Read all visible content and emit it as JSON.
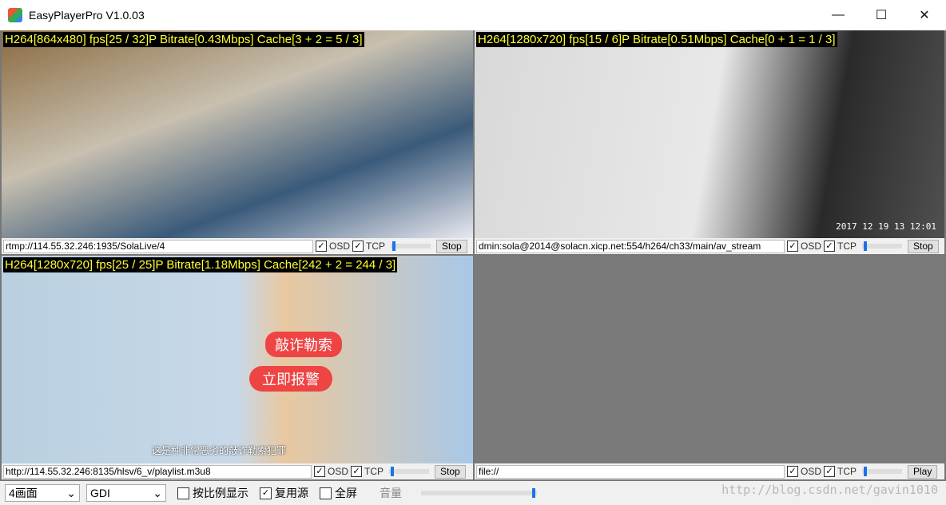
{
  "window": {
    "title": "EasyPlayerPro V1.0.03",
    "minimize": "—",
    "maximize": "☐",
    "close": "✕"
  },
  "panes": [
    {
      "osd": "H264[864x480] fps[25 / 32]P Bitrate[0.43Mbps] Cache[3 + 2 = 5 / 3]",
      "url": "rtmp://114.55.32.246:1935/SolaLive/4",
      "osd_checked": true,
      "tcp_checked": true,
      "button": "Stop",
      "volume": 0.05
    },
    {
      "osd": "H264[1280x720] fps[15 / 6]P Bitrate[0.51Mbps] Cache[0 + 1 = 1 / 3]",
      "url": "dmin:sola@2014@solacn.xicp.net:554/h264/ch33/main/av_stream",
      "osd_checked": true,
      "tcp_checked": true,
      "button": "Stop",
      "volume": 0.05,
      "timestamp": "2017 12 19 13 12:01"
    },
    {
      "osd": "H264[1280x720] fps[25 / 25]P Bitrate[1.18Mbps] Cache[242 + 2 = 244 / 3]",
      "url": "http://114.55.32.246:8135/hlsv/6_v/playlist.m3u8",
      "osd_checked": true,
      "tcp_checked": true,
      "button": "Stop",
      "volume": 0.05,
      "caption": "这是种非常恶劣的敲诈勒索犯罪",
      "sign1": "敲诈勒索",
      "sign2": "立即报警"
    },
    {
      "osd": "",
      "url": "file://",
      "osd_checked": true,
      "tcp_checked": true,
      "button": "Play",
      "volume": 0.05
    }
  ],
  "labels": {
    "osd": "OSD",
    "tcp": "TCP",
    "check": "✓"
  },
  "toolbar": {
    "layout": "4画面",
    "render": "GDI",
    "aspect": "按比例显示",
    "reuse": "复用源",
    "fullscreen": "全屏",
    "volume_label": "音量",
    "volume": 1.0,
    "aspect_checked": false,
    "reuse_checked": true,
    "fullscreen_checked": false
  },
  "watermark": "http://blog.csdn.net/gavin1010"
}
